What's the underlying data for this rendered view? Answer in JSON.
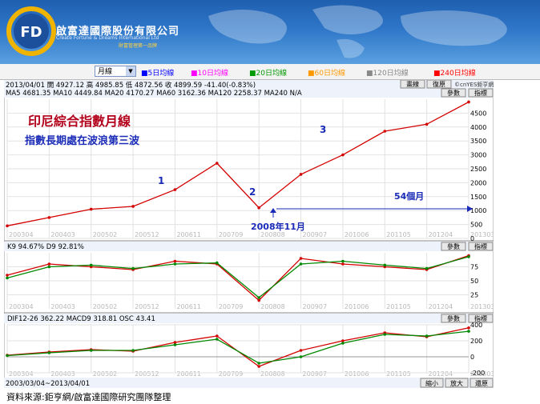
{
  "header": {
    "logo_letters": "FD",
    "company_name": "啟富達國際股份有限公司",
    "company_en": "Create Fortune & Dreams International Ltd",
    "slogan": "財富管理第一品牌"
  },
  "toolbar": {
    "period_value": "月線",
    "ma_legend": [
      {
        "label": "5日均線",
        "color": "#0000ff"
      },
      {
        "label": "10日均線",
        "color": "#ff00ff"
      },
      {
        "label": "20日均線",
        "color": "#009900"
      },
      {
        "label": "60日均線",
        "color": "#ff9900"
      },
      {
        "label": "120日均線",
        "color": "#888888"
      },
      {
        "label": "240日均線",
        "color": "#ff0000"
      }
    ]
  },
  "info": {
    "quote_line": "2013/04/01 開 4927.12 高 4985.85 低 4872.56 收 4899.59 -41.40(-0.83%)",
    "ma_line": "MA5 4681.35  MA10 4449.84  MA20 4170.27  MA60 3162.36  MA120 2258.37  MA240 N/A",
    "buttons": [
      "畫線",
      "復原",
      "參數",
      "指標"
    ],
    "copyright": "©cnYES鉅亨網",
    "kd_line": "K9 94.67%  D9 92.81%",
    "macd_line": "DIF12-26 362.22  MACD9 318.81  OSC 43.41",
    "date_range": "2003/03/04~2013/04/01",
    "zoom_buttons": [
      "縮小",
      "放大",
      "還原"
    ]
  },
  "annotations": {
    "title": "印尼綜合指數月線",
    "subtitle": "指數長期處在波浪第三波",
    "wave_labels": [
      "1",
      "2",
      "3"
    ],
    "date_label": "2008年11月",
    "span_label": "54個月"
  },
  "footer": {
    "source": "資料來源:鉅亨網/啟富達國際研究團隊整理"
  },
  "chart_data": [
    {
      "type": "line",
      "title": "印尼綜合指數月線",
      "x": [
        "200304",
        "200403",
        "200502",
        "200512",
        "200611",
        "200709",
        "200808",
        "200907",
        "201006",
        "201105",
        "201204",
        "201303"
      ],
      "series": [
        {
          "name": "收",
          "values": [
            450,
            750,
            1050,
            1150,
            1750,
            2700,
            1100,
            2300,
            3000,
            3850,
            4100,
            4900
          ]
        }
      ],
      "ylim": [
        0,
        5000
      ],
      "y_ticks": [
        0,
        500,
        1000,
        1500,
        2000,
        2500,
        3000,
        3500,
        4000,
        4500
      ]
    },
    {
      "type": "line",
      "title": "K9 94.67%  D9 92.81%",
      "x": [
        "200304",
        "200403",
        "200502",
        "200512",
        "200611",
        "200709",
        "200808",
        "200907",
        "201006",
        "201105",
        "201204",
        "201303"
      ],
      "series": [
        {
          "name": "K9",
          "values": [
            60,
            80,
            75,
            70,
            85,
            80,
            15,
            90,
            80,
            75,
            70,
            95
          ]
        },
        {
          "name": "D9",
          "values": [
            55,
            75,
            78,
            72,
            80,
            82,
            20,
            80,
            85,
            78,
            72,
            93
          ]
        }
      ],
      "ylim": [
        0,
        100
      ],
      "y_ticks": [
        25,
        50,
        75
      ]
    },
    {
      "type": "line",
      "title": "DIF12-26 362.22  MACD9 318.81  OSC 43.41",
      "x": [
        "200304",
        "200403",
        "200502",
        "200512",
        "200611",
        "200709",
        "200808",
        "200907",
        "201006",
        "201105",
        "201204",
        "201303"
      ],
      "series": [
        {
          "name": "DIF12-26",
          "values": [
            20,
            60,
            90,
            70,
            180,
            260,
            -120,
            80,
            200,
            300,
            250,
            362
          ]
        },
        {
          "name": "MACD9",
          "values": [
            15,
            50,
            80,
            80,
            150,
            220,
            -80,
            0,
            170,
            280,
            260,
            319
          ]
        }
      ],
      "ylim": [
        -200,
        400
      ],
      "y_ticks": [
        -200,
        0,
        200,
        400
      ]
    }
  ]
}
